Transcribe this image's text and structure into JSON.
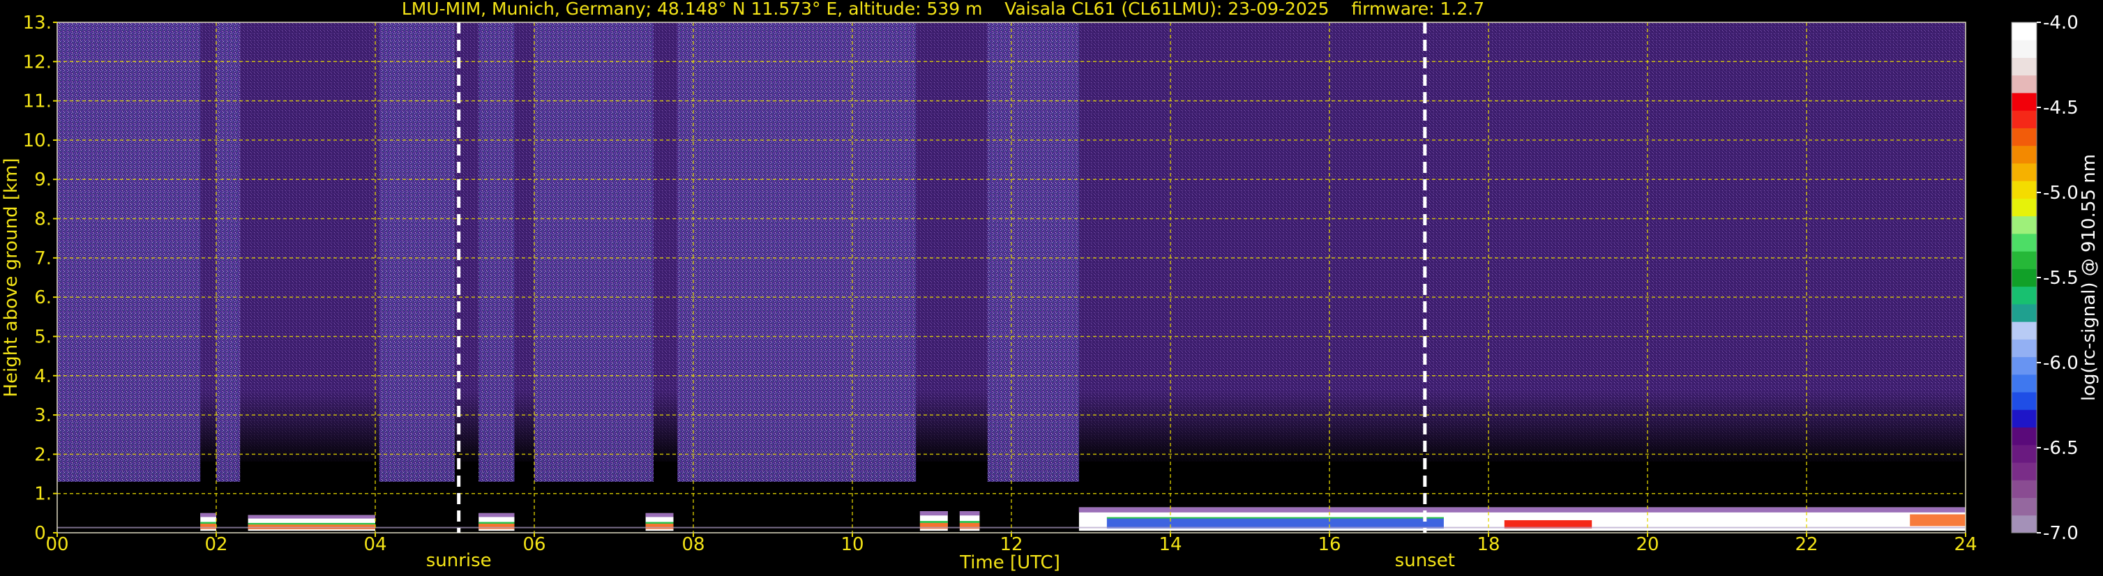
{
  "chart_data": {
    "type": "heatmap",
    "title": "LMU-MIM, Munich, Germany; 48.148° N 11.573° E, altitude: 539 m    Vaisala CL61 (CL61LMU): 23-09-2025    firmware: 1.2.7",
    "xlabel": "Time [UTC]",
    "ylabel": "Height above ground [km]",
    "xlim": [
      0,
      24
    ],
    "ylim": [
      0,
      13
    ],
    "x_ticks": [
      "00",
      "02",
      "04",
      "06",
      "08",
      "10",
      "12",
      "14",
      "16",
      "18",
      "20",
      "22",
      "24"
    ],
    "y_ticks": [
      "0.",
      "1.",
      "2.",
      "3.",
      "4.",
      "5.",
      "6.",
      "7.",
      "8.",
      "9.",
      "10.",
      "11.",
      "12.",
      "13."
    ],
    "grid": true,
    "events": [
      {
        "label": "sunrise",
        "time": 5.05
      },
      {
        "label": "sunset",
        "time": 17.2
      }
    ],
    "colorbar": {
      "label": "log(rc-signal) @ 910.55 nm",
      "min": -7.0,
      "max": -4.0,
      "ticks": [
        "-7.0",
        "-6.5",
        "-6.0",
        "-5.5",
        "-5.0",
        "-4.5",
        "-4.0"
      ],
      "colors": [
        "#a491b8",
        "#95689f",
        "#8a4c92",
        "#7a2d88",
        "#6a1a80",
        "#5a0a7a",
        "#1e16c8",
        "#1f4ee6",
        "#3f78ef",
        "#6894f2",
        "#93b0f3",
        "#b8cbf5",
        "#1fa08f",
        "#18c070",
        "#11a028",
        "#26b838",
        "#4ddd66",
        "#9ef07a",
        "#e6f20a",
        "#f4dc00",
        "#f6b100",
        "#f38900",
        "#f25c0a",
        "#f52818",
        "#f2000a",
        "#e6b8b8",
        "#ece0de",
        "#f6f6f6",
        "#ffffff"
      ]
    },
    "dense_noise_periods": [
      {
        "start": 0.0,
        "end": 1.8
      },
      {
        "start": 2.0,
        "end": 2.3
      },
      {
        "start": 4.05,
        "end": 5.0
      },
      {
        "start": 5.3,
        "end": 5.75
      },
      {
        "start": 6.0,
        "end": 7.5
      },
      {
        "start": 7.8,
        "end": 10.8
      },
      {
        "start": 11.7,
        "end": 12.85
      }
    ],
    "low_layers": [
      {
        "start": 1.8,
        "end": 2.0,
        "top_km": 0.5
      },
      {
        "start": 2.4,
        "end": 4.0,
        "top_km": 0.45
      },
      {
        "start": 5.3,
        "end": 5.75,
        "top_km": 0.5
      },
      {
        "start": 7.4,
        "end": 7.75,
        "top_km": 0.5
      },
      {
        "start": 10.85,
        "end": 11.2,
        "top_km": 0.55
      },
      {
        "start": 11.35,
        "end": 11.6,
        "top_km": 0.55
      },
      {
        "start": 12.85,
        "end": 24.0,
        "top_km": 0.65
      }
    ]
  }
}
